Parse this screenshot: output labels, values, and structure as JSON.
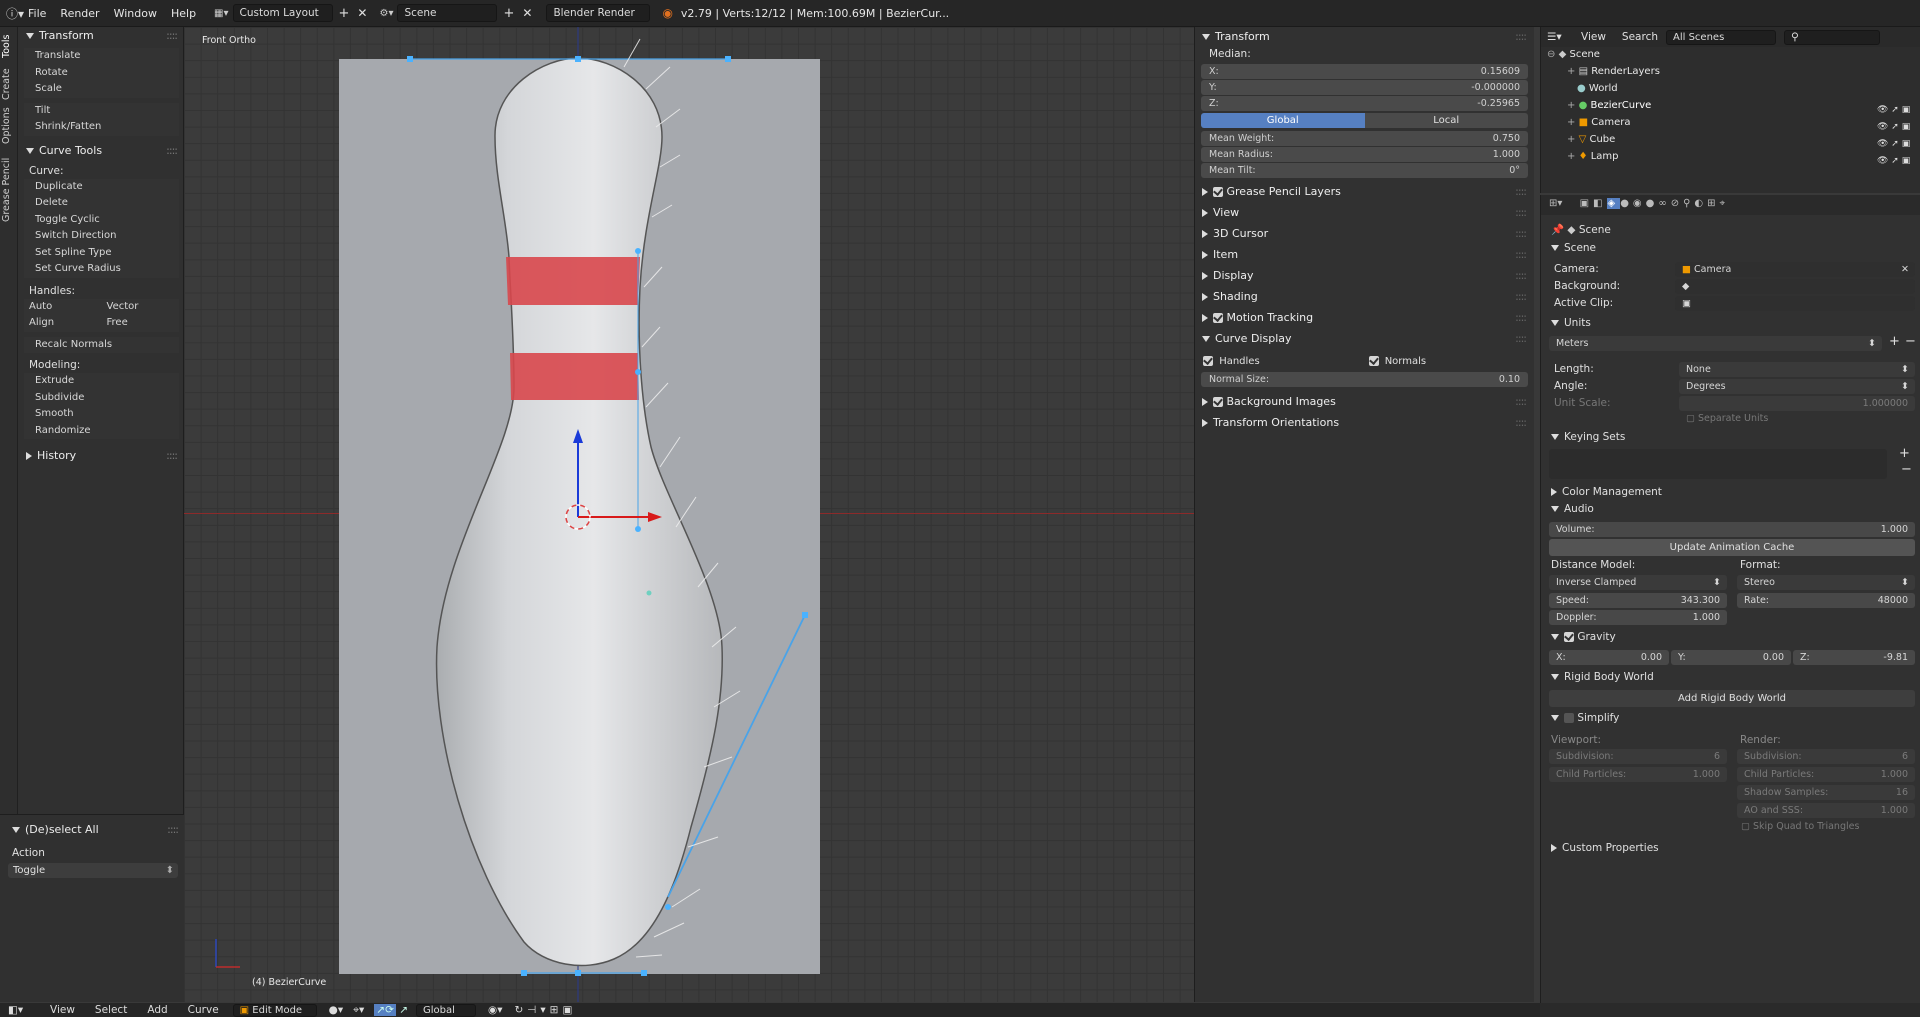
{
  "topbar": {
    "menus": [
      "File",
      "Render",
      "Window",
      "Help"
    ],
    "layout": "Custom Layout",
    "scene": "Scene",
    "engine": "Blender Render",
    "stats": "v2.79 | Verts:12/12 | Mem:100.69M | BezierCur..."
  },
  "tabs": [
    "Tools",
    "Create",
    "Options",
    "Grease Pencil"
  ],
  "toolshelf": {
    "transform_title": "Transform",
    "transform_tools": [
      "Translate",
      "Rotate",
      "Scale"
    ],
    "extra_tools": [
      "Tilt",
      "Shrink/Fatten"
    ],
    "curve_tools_title": "Curve Tools",
    "curve_label": "Curve:",
    "curve_tools": [
      "Duplicate",
      "Delete",
      "Toggle Cyclic",
      "Switch Direction",
      "Set Spline Type",
      "Set Curve Radius"
    ],
    "handles_label": "Handles:",
    "handles": [
      [
        "Auto",
        "Vector"
      ],
      [
        "Align",
        "Free"
      ]
    ],
    "recalc": "Recalc Normals",
    "modeling_label": "Modeling:",
    "modeling": [
      "Extrude",
      "Subdivide",
      "Smooth",
      "Randomize"
    ],
    "history": "History",
    "operator_title": "(De)select All",
    "action_label": "Action",
    "action_value": "Toggle"
  },
  "viewport": {
    "view_name": "Front Ortho",
    "object_label": "(4) BezierCurve"
  },
  "npanel": {
    "transform_title": "Transform",
    "median": "Median:",
    "x_label": "X:",
    "x": "0.15609",
    "y_label": "Y:",
    "y": "-0.000000",
    "z_label": "Z:",
    "z": "-0.25965",
    "global": "Global",
    "local": "Local",
    "mean_weight_label": "Mean Weight:",
    "mean_weight": "0.750",
    "mean_radius_label": "Mean Radius:",
    "mean_radius": "1.000",
    "mean_tilt_label": "Mean Tilt:",
    "mean_tilt": "0°",
    "sections": [
      "Grease Pencil Layers",
      "View",
      "3D Cursor",
      "Item",
      "Display",
      "Shading",
      "Motion Tracking"
    ],
    "curve_display": "Curve Display",
    "handles": "Handles",
    "normals": "Normals",
    "normal_size_label": "Normal Size:",
    "normal_size": "0.10",
    "background_images": "Background Images",
    "transform_orientations": "Transform Orientations"
  },
  "outliner": {
    "view": "View",
    "search": "Search",
    "filter": "All Scenes",
    "items": [
      "Scene",
      "RenderLayers",
      "World",
      "BezierCurve",
      "Camera",
      "Cube",
      "Lamp"
    ]
  },
  "props": {
    "context": "Scene",
    "scene_title": "Scene",
    "camera_label": "Camera:",
    "camera_value": "Camera",
    "background_label": "Background:",
    "active_clip_label": "Active Clip:",
    "units_title": "Units",
    "units_preset": "Meters",
    "length_label": "Length:",
    "length_value": "None",
    "angle_label": "Angle:",
    "angle_value": "Degrees",
    "unit_scale_label": "Unit Scale:",
    "unit_scale": "1.000000",
    "separate_units": "Separate Units",
    "keying_title": "Keying Sets",
    "color_mgmt": "Color Management",
    "audio_title": "Audio",
    "volume_label": "Volume:",
    "volume": "1.000",
    "update_cache": "Update Animation Cache",
    "distance_model_label": "Distance Model:",
    "distance_model": "Inverse Clamped",
    "format_label": "Format:",
    "format": "Stereo",
    "speed_label": "Speed:",
    "speed": "343.300",
    "rate_label": "Rate:",
    "rate": "48000",
    "doppler_label": "Doppler:",
    "doppler": "1.000",
    "gravity_title": "Gravity",
    "gx_label": "X:",
    "gx": "0.00",
    "gy_label": "Y:",
    "gy": "0.00",
    "gz_label": "Z:",
    "gz": "-9.81",
    "rigid_title": "Rigid Body World",
    "add_rigid": "Add Rigid Body World",
    "simplify_title": "Simplify",
    "viewport_label": "Viewport:",
    "render_label": "Render:",
    "subdivision_label": "Subdivision:",
    "subdivision_v": "6",
    "subdivision_r": "6",
    "child_label": "Child Particles:",
    "child_v": "1.000",
    "child_r": "1.000",
    "shadow_label": "Shadow Samples:",
    "shadow": "16",
    "ao_label": "AO and SSS:",
    "ao": "1.000",
    "skip_quad": "Skip Quad to Triangles",
    "custom_props": "Custom Properties"
  },
  "bottombar": {
    "menus": [
      "View",
      "Select",
      "Add",
      "Curve"
    ],
    "mode": "Edit Mode",
    "orientation": "Global"
  }
}
